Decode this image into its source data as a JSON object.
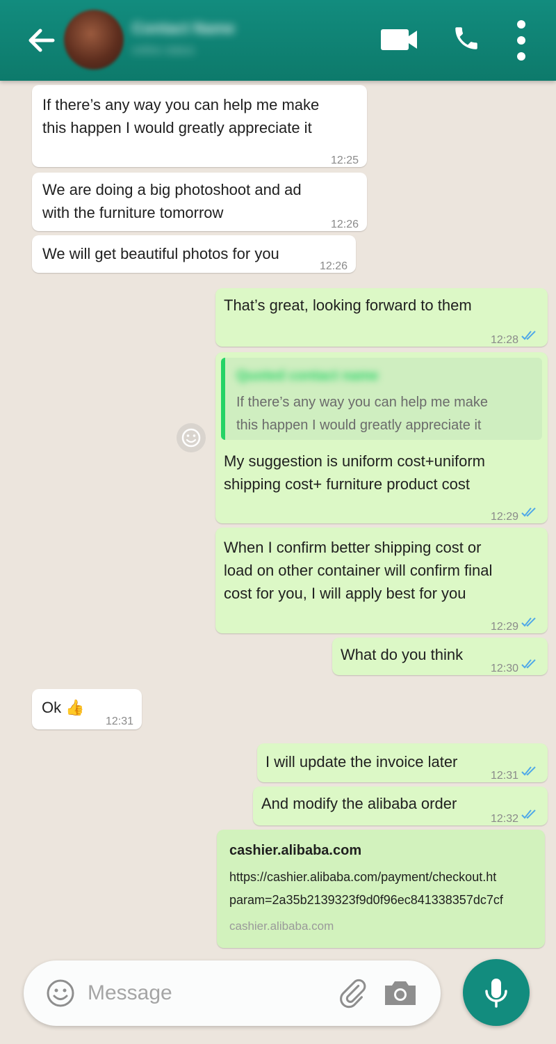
{
  "header": {
    "contact_name": "Contact Name",
    "contact_status": "online status",
    "icons": {
      "back": "arrow-left-icon",
      "video": "video-camera-icon",
      "call": "phone-icon",
      "menu": "more-vertical-icon"
    }
  },
  "messages": [
    {
      "direction": "in",
      "lines": [
        "If there’s any way you can help me make",
        "this happen I would greatly appreciate it"
      ],
      "time": "12:25"
    },
    {
      "direction": "in",
      "lines": [
        "We are doing a big photoshoot and ad",
        "with the furniture tomorrow"
      ],
      "time": "12:26"
    },
    {
      "direction": "in",
      "lines": [
        "We will get beautiful photos for you"
      ],
      "time": "12:26"
    },
    {
      "direction": "out",
      "lines": [
        "That’s great, looking forward to them"
      ],
      "time": "12:28",
      "status": "read"
    },
    {
      "direction": "out",
      "quote": {
        "author": "Quoted contact name",
        "lines": [
          "If there’s any way you can help me make",
          "this happen I would greatly appreciate it"
        ]
      },
      "lines": [
        "My suggestion is  uniform cost+uniform",
        "shipping cost+ furniture product cost"
      ],
      "time": "12:29",
      "status": "read"
    },
    {
      "direction": "out",
      "lines": [
        "When I confirm better shipping cost or",
        "load on other container will confirm final",
        "cost for you, I will apply best for you"
      ],
      "time": "12:29",
      "status": "read"
    },
    {
      "direction": "out",
      "lines": [
        "What do you think"
      ],
      "time": "12:30",
      "status": "read"
    },
    {
      "direction": "in",
      "lines": [
        "Ok 👍"
      ],
      "time": "12:31"
    },
    {
      "direction": "out",
      "lines": [
        "I will update the invoice later"
      ],
      "time": "12:31",
      "status": "read"
    },
    {
      "direction": "out",
      "lines": [
        "And modify the alibaba order"
      ],
      "time": "12:32",
      "status": "read"
    },
    {
      "direction": "out",
      "link_preview": {
        "title": "cashier.alibaba.com",
        "url_lines": [
          "https://cashier.alibaba.com/payment/checkout.ht",
          "param=2a35b2139323f9d0f96ec841338357dc7cf"
        ],
        "domain": "cashier.alibaba.com"
      }
    }
  ],
  "composer": {
    "placeholder": "Message",
    "icons": {
      "emoji": "smiley-icon",
      "attach": "paperclip-icon",
      "camera": "camera-icon",
      "send": "microphone-icon"
    }
  },
  "colors": {
    "header": "#128c7e",
    "incoming": "#ffffff",
    "outgoing": "#dcf8c6",
    "read_ticks": "#4fa8e8",
    "background": "#ece5dd"
  }
}
